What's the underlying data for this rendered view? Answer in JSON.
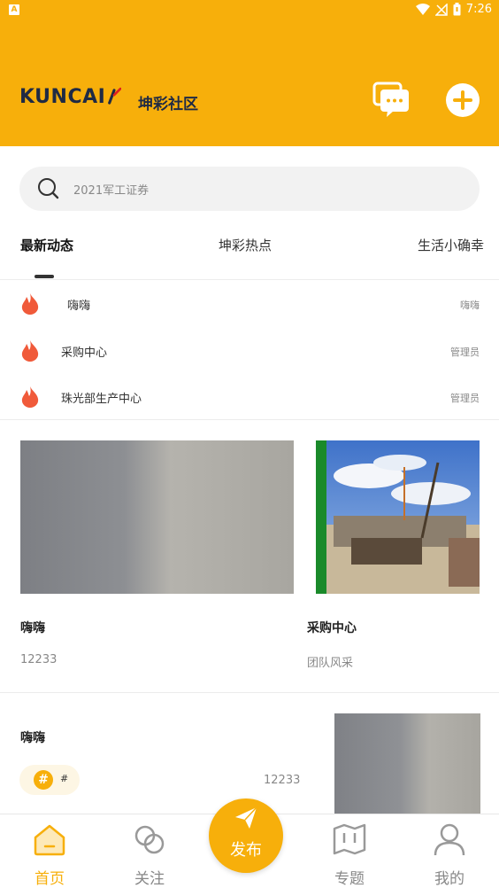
{
  "status_bar": {
    "time": "7:26",
    "indicator": "A"
  },
  "header": {
    "logo_text": "KUNCAI",
    "title": "坤彩社区",
    "icons": {
      "message": "chat-bubbles-icon",
      "add": "plus-circle-icon"
    }
  },
  "search": {
    "placeholder": "2021军工证券"
  },
  "tabs": [
    {
      "label": "最新动态",
      "active": true
    },
    {
      "label": "坤彩热点",
      "active": false
    },
    {
      "label": "生活小确幸",
      "active": false
    }
  ],
  "hot_list": [
    {
      "title": "嗨嗨",
      "tag": "嗨嗨"
    },
    {
      "title": "采购中心",
      "tag": "管理员"
    },
    {
      "title": "珠光部生产中心",
      "tag": "管理员"
    }
  ],
  "cards": [
    {
      "title": "嗨嗨",
      "subtitle": "12233"
    },
    {
      "title": "采购中心",
      "subtitle": "团队风采"
    }
  ],
  "post": {
    "title": "嗨嗨",
    "hashtag": "#",
    "hashtag_text": "#",
    "count": "12233"
  },
  "bottom_nav": {
    "items": [
      {
        "label": "首页",
        "active": true
      },
      {
        "label": "关注",
        "active": false
      },
      {
        "label": "专题",
        "active": false
      },
      {
        "label": "我的",
        "active": false
      }
    ],
    "publish_label": "发布"
  },
  "colors": {
    "accent": "#F7AF0B",
    "fire": "#F05A3A",
    "brand_navy": "#1f2a44",
    "brand_red": "#E02020"
  }
}
